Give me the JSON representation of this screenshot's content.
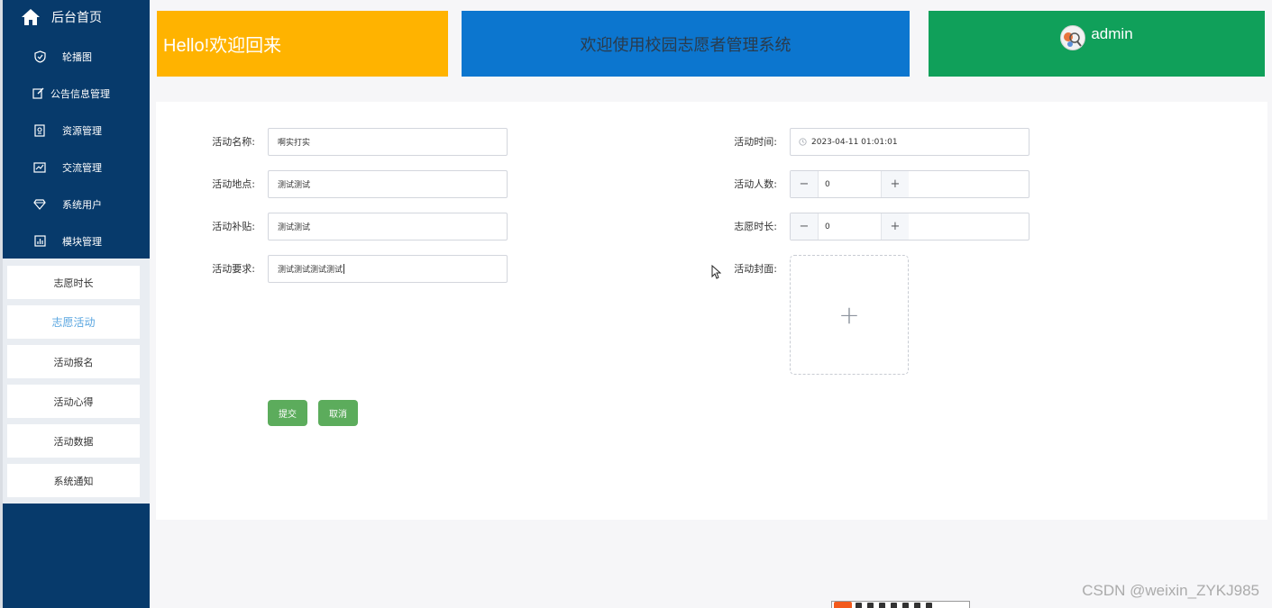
{
  "sidebar": {
    "home_label": "后台首页",
    "menu": [
      {
        "label": "轮播图",
        "icon": "shield-icon"
      },
      {
        "label": "公告信息管理",
        "icon": "edit-icon"
      },
      {
        "label": "资源管理",
        "icon": "document-icon"
      },
      {
        "label": "交流管理",
        "icon": "chart-icon"
      },
      {
        "label": "系统用户",
        "icon": "diamond-icon"
      },
      {
        "label": "模块管理",
        "icon": "bar-chart-icon"
      }
    ],
    "submenu": [
      {
        "label": "志愿时长"
      },
      {
        "label": "志愿活动",
        "active": true
      },
      {
        "label": "活动报名"
      },
      {
        "label": "活动心得"
      },
      {
        "label": "活动数据"
      },
      {
        "label": "系统通知"
      }
    ]
  },
  "header": {
    "greeting": "Hello!欢迎回来",
    "system_title": "欢迎使用校园志愿者管理系统",
    "username": "admin"
  },
  "form": {
    "activity_name": {
      "label": "活动名称:",
      "value": "啊实打实"
    },
    "activity_location": {
      "label": "活动地点:",
      "value": "测试测试"
    },
    "activity_subsidy": {
      "label": "活动补贴:",
      "value": "测试测试"
    },
    "activity_requirement": {
      "label": "活动要求:",
      "value": "测试测试测试测试"
    },
    "activity_time": {
      "label": "活动时间:",
      "value": "2023-04-11 01:01:01"
    },
    "participant_count": {
      "label": "活动人数:",
      "value": "0",
      "minus": "−",
      "plus": "+"
    },
    "volunteer_hours": {
      "label": "志愿时长:",
      "value": "0",
      "minus": "−",
      "plus": "+"
    },
    "cover": {
      "label": "活动封面:",
      "plus": "+"
    },
    "submit_label": "提交",
    "cancel_label": "取消"
  },
  "watermark": "CSDN @weixin_ZYKJ985",
  "colors": {
    "sidebar": "#073a6b",
    "banner_yellow": "#ffb300",
    "banner_blue": "#0c76cf",
    "banner_green": "#10a05a",
    "button_green": "#5cac5c",
    "active_link": "#5aa6e0"
  }
}
